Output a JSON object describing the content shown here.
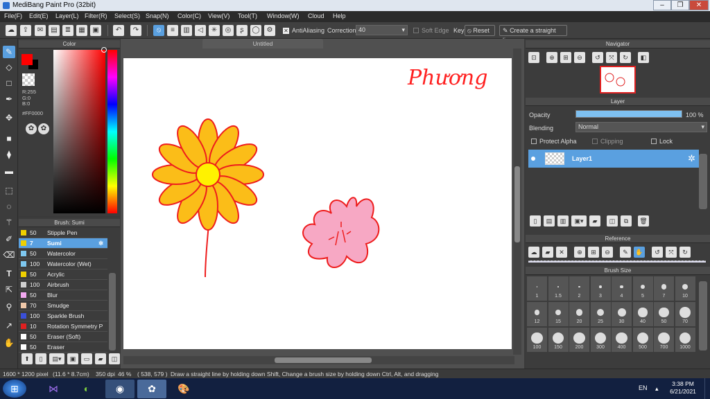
{
  "window": {
    "title": "MediBang Paint Pro (32bit)",
    "minimize": "–",
    "maximize": "❐",
    "close": "✕"
  },
  "menu": [
    "File(F)",
    "Edit(E)",
    "Layer(L)",
    "Filter(R)",
    "Select(S)",
    "Snap(N)",
    "Color(C)",
    "View(V)",
    "Tool(T)",
    "Window(W)",
    "Cloud",
    "Help"
  ],
  "toolbar": {
    "antialiasing_label": "AntiAliasing",
    "correction_label": "Correction",
    "correction_value": "40",
    "soft_edge_label": "Soft Edge",
    "key_label": "Key",
    "reset_label": "Reset",
    "straight_line_label": "Create a straight line"
  },
  "color_panel": {
    "title": "Color",
    "r": "R:255",
    "g": "G:0",
    "b": "B:0",
    "hex": "#FF0000",
    "fg_color": "#ff0000",
    "bg_color": "#000000"
  },
  "brush_panel": {
    "title": "Brush: Sumi",
    "brushes": [
      {
        "size": "50",
        "name": "Stipple Pen",
        "color": "#f0d000"
      },
      {
        "size": "7",
        "name": "Sumi",
        "color": "#f0d000"
      },
      {
        "size": "50",
        "name": "Watercolor",
        "color": "#7ec8f0"
      },
      {
        "size": "100",
        "name": "Watercolor (Wet)",
        "color": "#7ec8f0"
      },
      {
        "size": "50",
        "name": "Acrylic",
        "color": "#f0d000"
      },
      {
        "size": "100",
        "name": "Airbrush",
        "color": "#cfcfcf"
      },
      {
        "size": "50",
        "name": "Blur",
        "color": "#f2a8f0"
      },
      {
        "size": "70",
        "name": "Smudge",
        "color": "#f0c8a8"
      },
      {
        "size": "100",
        "name": "Sparkle Brush",
        "color": "#3a4fd8"
      },
      {
        "size": "10",
        "name": "Rotation Symmetry P",
        "color": "#e02020"
      },
      {
        "size": "50",
        "name": "Eraser (Soft)",
        "color": "#ffffff"
      },
      {
        "size": "50",
        "name": "Eraser",
        "color": "#ffffff"
      }
    ]
  },
  "canvas": {
    "tab_title": "Untitled",
    "signature_text": "Phương"
  },
  "navigator": {
    "title": "Navigator"
  },
  "layer_panel": {
    "title": "Layer",
    "opacity_label": "Opacity",
    "opacity_value": "100 %",
    "opacity_fraction": 1.0,
    "blending_label": "Blending",
    "blending_value": "Normal",
    "protect_alpha": "Protect Alpha",
    "clipping": "Clipping",
    "lock": "Lock",
    "layer_name": "Layer1"
  },
  "reference_panel": {
    "title": "Reference"
  },
  "brush_size_panel": {
    "title": "Brush Size",
    "sizes": [
      "1",
      "1.5",
      "2",
      "3",
      "4",
      "5",
      "7",
      "10",
      "12",
      "15",
      "20",
      "25",
      "30",
      "40",
      "50",
      "70",
      "100",
      "150",
      "200",
      "300",
      "400",
      "500",
      "700",
      "1000"
    ]
  },
  "status": {
    "size": "1600 * 1200 pixel",
    "physical": "(11.6 * 8.7cm)",
    "dpi": "350 dpi",
    "zoom": "46 %",
    "coords": "( 538, 579 )",
    "hint": "Draw a straight line by holding down Shift, Change a brush size by holding down Ctrl, Alt, and dragging"
  },
  "taskbar": {
    "lang": "EN",
    "time": "3:38 PM",
    "date": "6/21/2021"
  }
}
